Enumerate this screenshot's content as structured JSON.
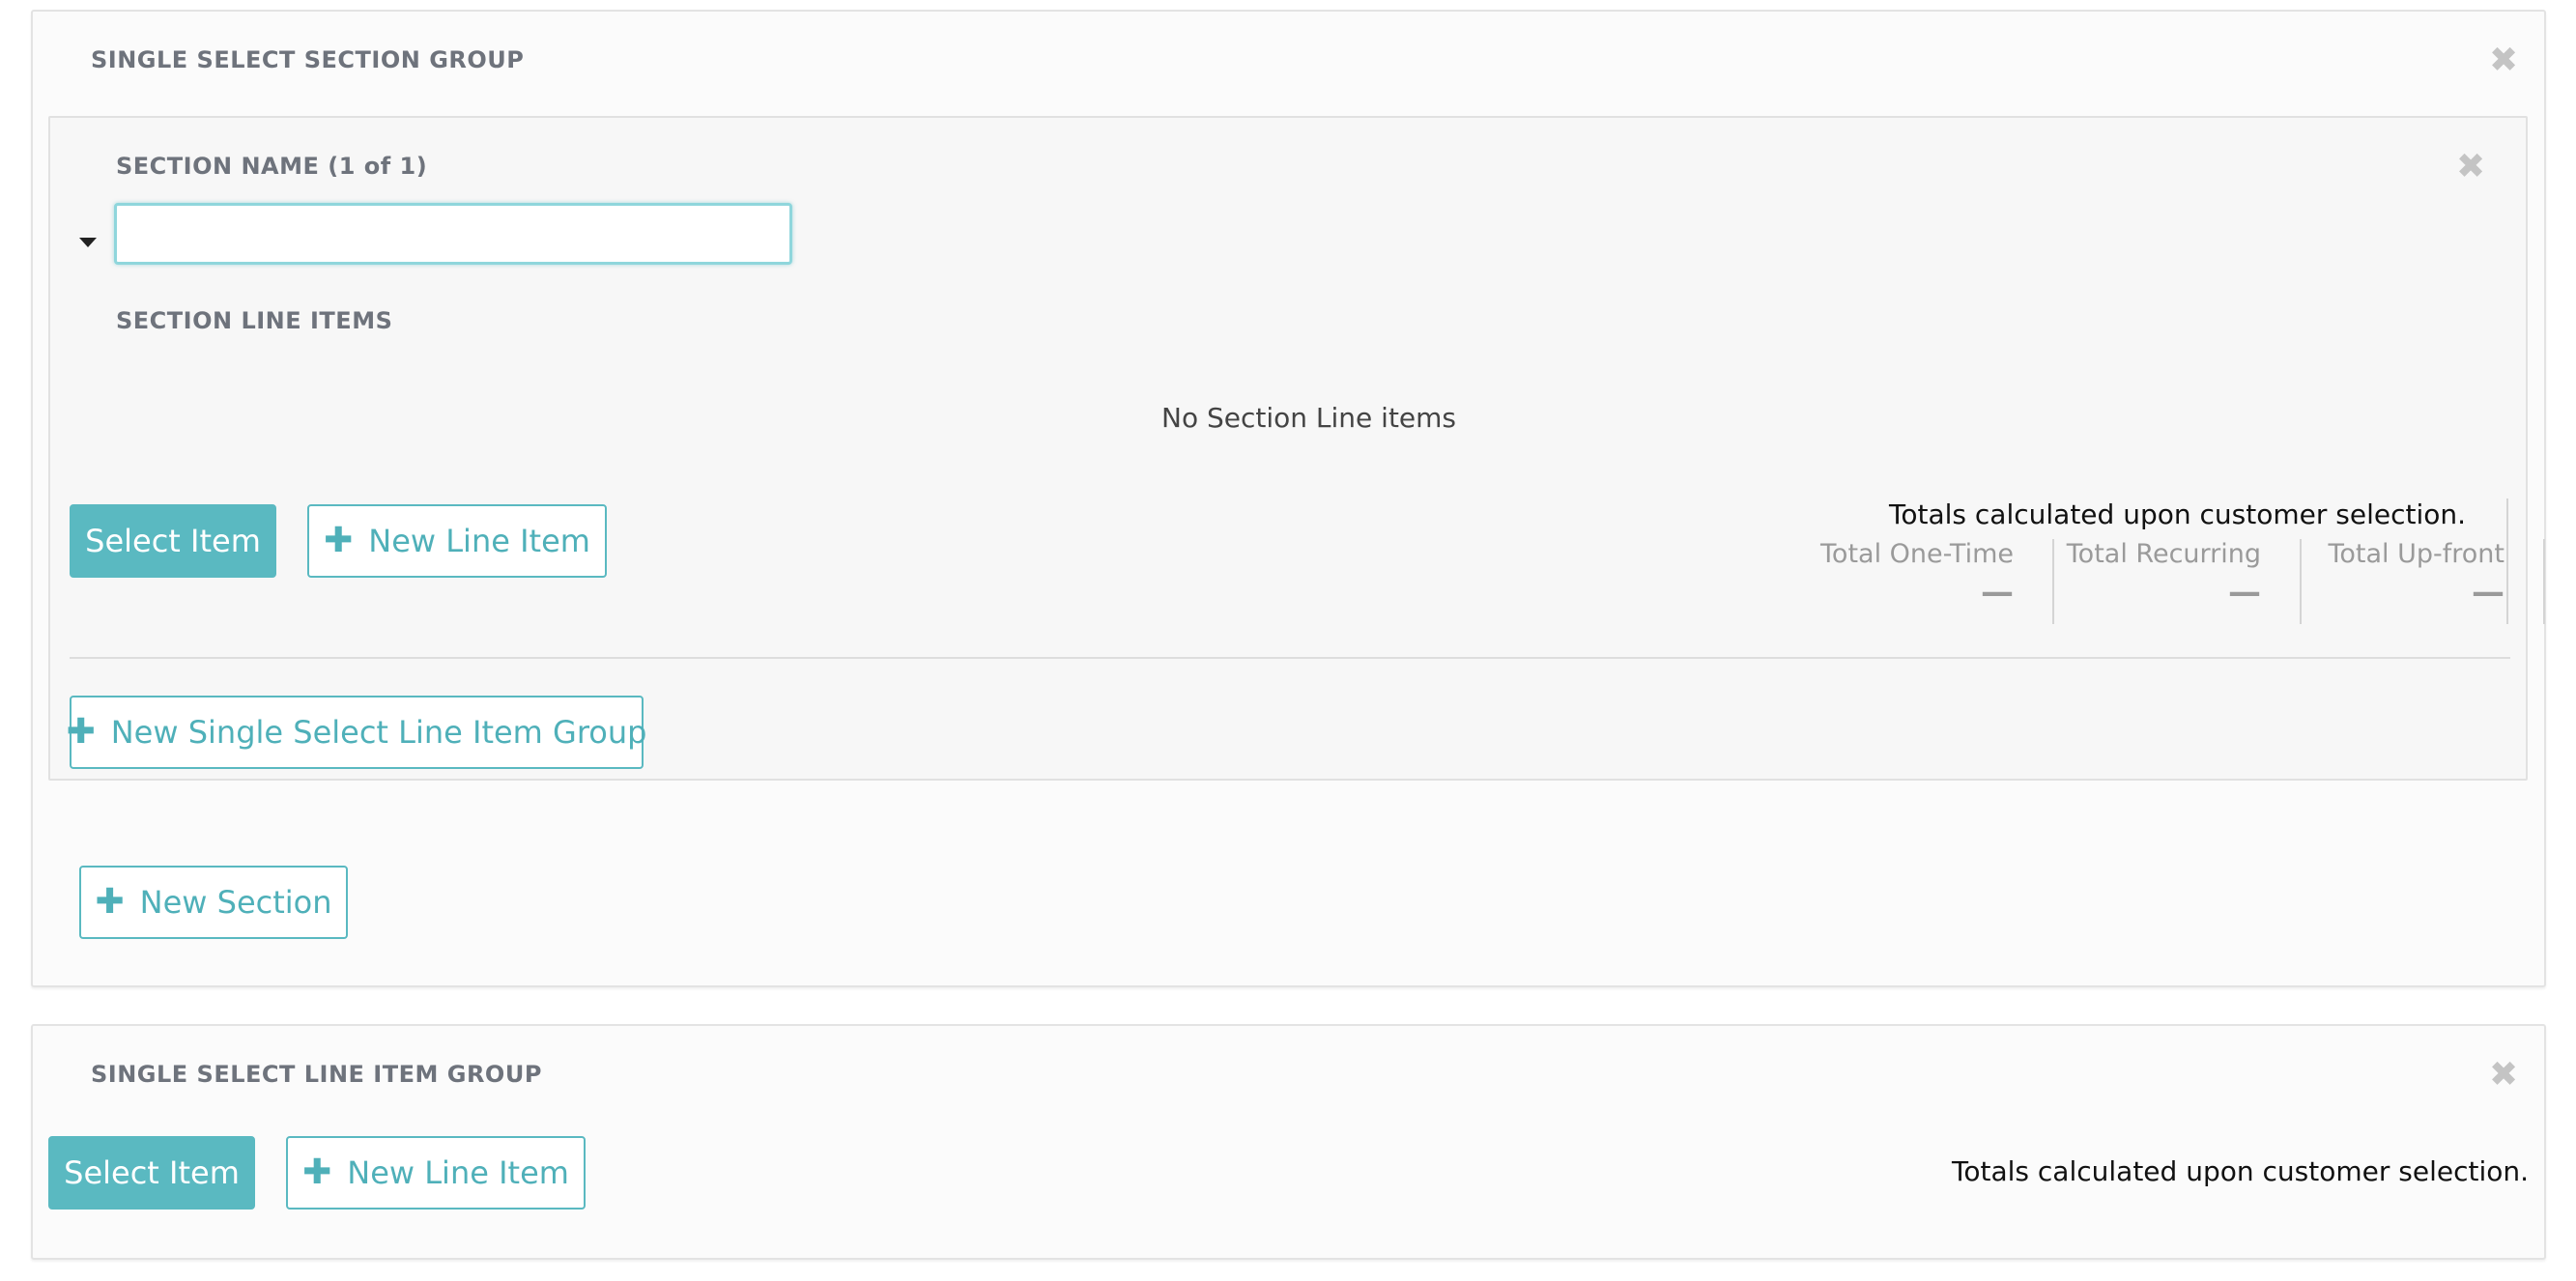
{
  "section_group": {
    "heading": "SINGLE SELECT SECTION GROUP",
    "close_glyph": "✖",
    "section": {
      "heading": "SECTION NAME (1 of 1)",
      "close_glyph": "✖",
      "name_input": {
        "value": "",
        "placeholder": ""
      },
      "line_items_heading": "SECTION LINE ITEMS",
      "empty_message": "No Section Line items",
      "select_item_label": "Select Item",
      "new_line_item_label": "New Line Item",
      "totals_note": "Totals calculated upon customer selection.",
      "totals": [
        {
          "label": "Total One-Time",
          "value": "—"
        },
        {
          "label": "Total Recurring",
          "value": "—"
        },
        {
          "label": "Total Up-front",
          "value": "—"
        }
      ],
      "new_group_label": "New Single Select Line Item Group"
    },
    "new_section_label": "New Section"
  },
  "line_item_group": {
    "heading": "SINGLE SELECT LINE ITEM GROUP",
    "close_glyph": "✖",
    "select_item_label": "Select Item",
    "new_line_item_label": "New Line Item",
    "totals_note": "Totals calculated upon customer selection."
  },
  "icons": {
    "plus": "✚",
    "close": "close-icon",
    "caret": "caret-down-icon"
  },
  "colors": {
    "accent": "#5ab9c1",
    "heading": "#6e737c",
    "muted": "#9a9a9a"
  }
}
